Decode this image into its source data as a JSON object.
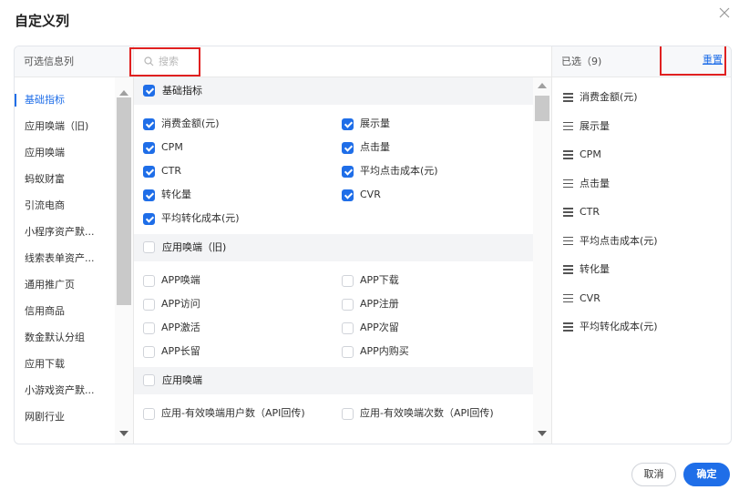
{
  "dialog": {
    "title": "自定义列",
    "close_icon": "close-icon"
  },
  "left": {
    "header": "可选信息列",
    "categories": [
      {
        "label": "基础指标",
        "active": true
      },
      {
        "label": "应用唤端（旧)"
      },
      {
        "label": "应用唤端"
      },
      {
        "label": "蚂蚁财富"
      },
      {
        "label": "引流电商"
      },
      {
        "label": "小程序资产默..."
      },
      {
        "label": "线索表单资产..."
      },
      {
        "label": "通用推广页"
      },
      {
        "label": "信用商品"
      },
      {
        "label": "数金默认分组"
      },
      {
        "label": "应用下载"
      },
      {
        "label": "小游戏资产默..."
      },
      {
        "label": "网剧行业"
      }
    ]
  },
  "middle": {
    "search_placeholder": "搜索",
    "groups": [
      {
        "title": "基础指标",
        "checked": true,
        "items": [
          {
            "label": "消费金额(元)",
            "checked": true
          },
          {
            "label": "展示量",
            "checked": true
          },
          {
            "label": "CPM",
            "checked": true
          },
          {
            "label": "点击量",
            "checked": true
          },
          {
            "label": "CTR",
            "checked": true
          },
          {
            "label": "平均点击成本(元)",
            "checked": true
          },
          {
            "label": "转化量",
            "checked": true
          },
          {
            "label": "CVR",
            "checked": true
          },
          {
            "label": "平均转化成本(元)",
            "checked": true
          }
        ]
      },
      {
        "title": "应用唤端（旧)",
        "checked": false,
        "items": [
          {
            "label": "APP唤端",
            "checked": false
          },
          {
            "label": "APP下载",
            "checked": false
          },
          {
            "label": "APP访问",
            "checked": false
          },
          {
            "label": "APP注册",
            "checked": false
          },
          {
            "label": "APP激活",
            "checked": false
          },
          {
            "label": "APP次留",
            "checked": false
          },
          {
            "label": "APP长留",
            "checked": false
          },
          {
            "label": "APP内购买",
            "checked": false
          }
        ]
      },
      {
        "title": "应用唤端",
        "checked": false,
        "items": [
          {
            "label": "应用-有效唤端用户数（API回传)",
            "checked": false
          },
          {
            "label": "应用-有效唤端次数（API回传)",
            "checked": false
          }
        ]
      }
    ]
  },
  "right": {
    "header": "已选（9)",
    "reset_label": "重置",
    "selected": [
      "消费金额(元)",
      "展示量",
      "CPM",
      "点击量",
      "CTR",
      "平均点击成本(元)",
      "转化量",
      "CVR",
      "平均转化成本(元)"
    ]
  },
  "footer": {
    "cancel_label": "取消",
    "ok_label": "确定"
  },
  "colors": {
    "accent": "#1f6ee8",
    "highlight_box": "#e02020"
  }
}
